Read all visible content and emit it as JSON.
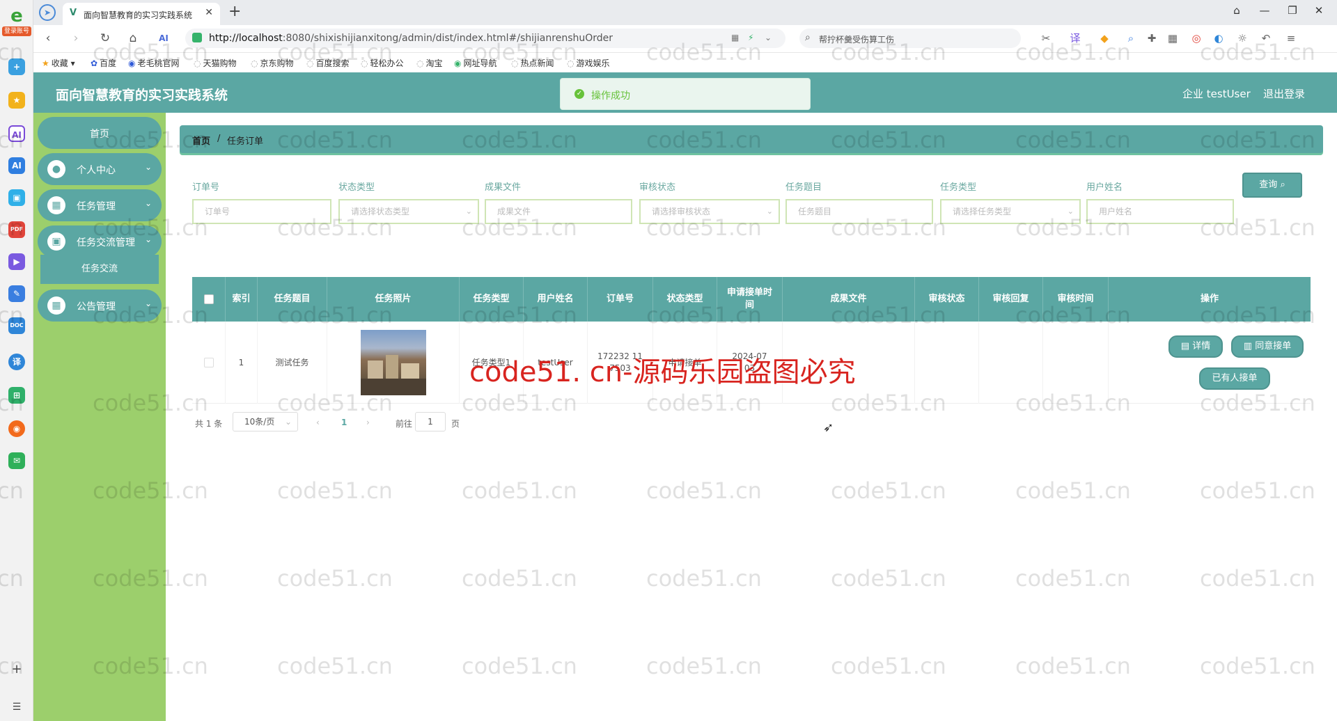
{
  "browser": {
    "rail_tag": "登录账号",
    "tab_title": "面向智慧教育的实习实践系统",
    "url_host": "http://localhost",
    "url_rest": ":8080/shixishijianxitong/admin/dist/index.html#/shijianrenshuOrder",
    "search_text": "帮拧杯羹受伤算工伤",
    "bookmarks": [
      "收藏",
      "百度",
      "老毛桃官网",
      "天猫购物",
      "京东购物",
      "百度搜索",
      "轻松办公",
      "淘宝",
      "网址导航",
      "热点新闻",
      "游戏娱乐"
    ]
  },
  "app": {
    "title": "面向智慧教育的实习实践系统",
    "toast": "操作成功",
    "user": "企业 testUser",
    "logout": "退出登录"
  },
  "sidebar": {
    "home": "首页",
    "items": [
      {
        "label": "个人中心",
        "icon": "user-icon"
      },
      {
        "label": "任务管理",
        "icon": "grid-icon"
      },
      {
        "label": "任务交流管理",
        "icon": "briefcase-icon"
      },
      {
        "label": "公告管理",
        "icon": "grid-icon"
      }
    ],
    "sub_item": "任务交流"
  },
  "breadcrumb": {
    "home": "首页",
    "sep": "/",
    "current": "任务订单"
  },
  "filters": [
    {
      "label": "订单号",
      "placeholder": "订单号",
      "select": false
    },
    {
      "label": "状态类型",
      "placeholder": "请选择状态类型",
      "select": true
    },
    {
      "label": "成果文件",
      "placeholder": "成果文件",
      "select": false
    },
    {
      "label": "审核状态",
      "placeholder": "请选择审核状态",
      "select": true
    },
    {
      "label": "任务题目",
      "placeholder": "任务题目",
      "select": false
    },
    {
      "label": "任务类型",
      "placeholder": "请选择任务类型",
      "select": true
    },
    {
      "label": "用户姓名",
      "placeholder": "用户姓名",
      "select": false
    }
  ],
  "query_button": "查询",
  "table": {
    "headers": [
      "索引",
      "任务题目",
      "任务照片",
      "任务类型",
      "用户姓名",
      "订单号",
      "状态类型",
      "申请接单时间",
      "成果文件",
      "审核状态",
      "审核回复",
      "审核时间",
      "操作"
    ],
    "rows": [
      {
        "index": "1",
        "title": "测试任务",
        "type": "任务类型1",
        "user": "testUser",
        "order": "172232 11 7503",
        "status": "申请接单",
        "time": "2024-07 03",
        "file": "",
        "audit": "",
        "reply": "",
        "audit_time": ""
      }
    ],
    "actions": {
      "detail": "详情",
      "agree": "同意接单",
      "taken": "已有人接单"
    }
  },
  "pagination": {
    "total": "共 1 条",
    "page_size": "10条/页",
    "current": "1",
    "goto": "前往",
    "goto_value": "1",
    "page_suffix": "页"
  },
  "watermark": {
    "main": "code51. cn-源码乐园盗图必究",
    "tile": "code51.cn"
  }
}
